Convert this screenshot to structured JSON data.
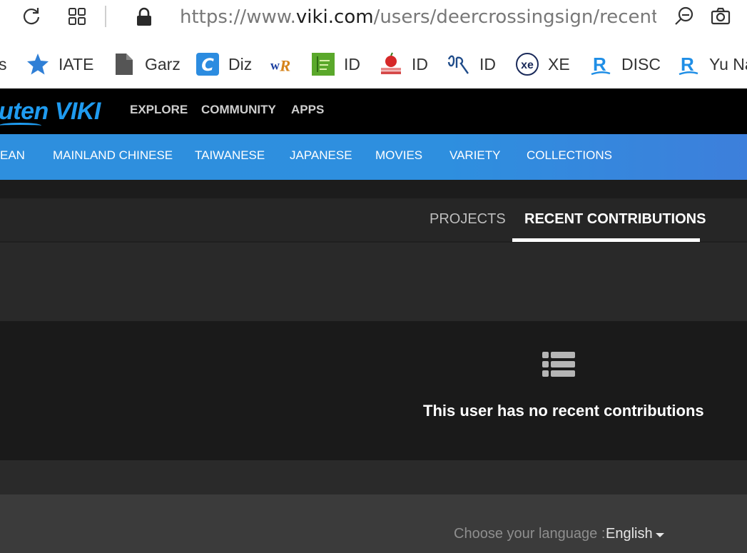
{
  "browser": {
    "url_prefix": "https://www.",
    "url_domain": "viki.com",
    "url_path": "/users/deercrossingsign/recent_c"
  },
  "bookmarks": [
    {
      "label": "s",
      "icon": "truncated"
    },
    {
      "label": "IATE",
      "icon": "star-icon"
    },
    {
      "label": "Garz",
      "icon": "document-icon"
    },
    {
      "label": "Diz",
      "icon": "c-logo-icon"
    },
    {
      "label": "",
      "icon": "wr-logo-icon"
    },
    {
      "label": "ID",
      "icon": "green-book-icon"
    },
    {
      "label": "ID",
      "icon": "apple-book-icon"
    },
    {
      "label": "ID",
      "icon": "script-icon"
    },
    {
      "label": "XE",
      "icon": "xe-logo-icon"
    },
    {
      "label": "DISC",
      "icon": "r-logo-icon"
    },
    {
      "label": "Yu Na",
      "icon": "r-logo-icon"
    }
  ],
  "brand": {
    "logo_text": "uten VIKI",
    "accent": "#1f9bf0"
  },
  "top_nav": [
    "EXPLORE",
    "COMMUNITY",
    "APPS"
  ],
  "categories": [
    "EAN",
    "MAINLAND CHINESE",
    "TAIWANESE",
    "JAPANESE",
    "MOVIES",
    "VARIETY",
    "COLLECTIONS"
  ],
  "tabs": {
    "projects": "PROJECTS",
    "recent": "RECENT CONTRIBUTIONS",
    "active": "recent"
  },
  "empty_state": {
    "icon": "list-icon",
    "message": "This user has no recent contributions"
  },
  "footer": {
    "language_label": "Choose your language :",
    "language_value": "English"
  }
}
